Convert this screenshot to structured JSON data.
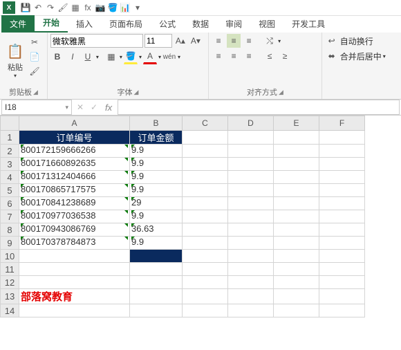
{
  "qat_icons": [
    "save-icon",
    "undo-icon",
    "redo-icon",
    "brush-icon",
    "border-icon",
    "fx-icon",
    "camera-icon",
    "fill-icon",
    "table-icon",
    "more-icon"
  ],
  "qat_glyphs": [
    "💾",
    "↶",
    "↷",
    "🖌",
    "▦",
    "fx",
    "📷",
    "🪣",
    "📊",
    "▾"
  ],
  "tabs": {
    "file": "文件",
    "home": "开始",
    "insert": "插入",
    "layout": "页面布局",
    "formula": "公式",
    "data": "数据",
    "review": "审阅",
    "view": "视图",
    "dev": "开发工具"
  },
  "ribbon": {
    "clipboard": {
      "paste": "粘贴",
      "label": "剪贴板"
    },
    "font": {
      "name": "微软雅黑",
      "size": "11",
      "label": "字体"
    },
    "align": {
      "wrap": "自动换行",
      "merge": "合并后居中",
      "label": "对齐方式"
    }
  },
  "namebox": "I18",
  "columns": [
    "A",
    "B",
    "C",
    "D",
    "E",
    "F"
  ],
  "header_row": {
    "A": "订单编号",
    "B": "订单金额"
  },
  "rows": [
    {
      "A": "800172159666266",
      "B": "9.9"
    },
    {
      "A": "800171660892635",
      "B": "9.9"
    },
    {
      "A": "800171312404666",
      "B": "9.9"
    },
    {
      "A": "800170865717575",
      "B": "9.9"
    },
    {
      "A": "800170841238689",
      "B": "29"
    },
    {
      "A": "800170977036538",
      "B": "9.9"
    },
    {
      "A": "800170943086769",
      "B": "36.63"
    },
    {
      "A": "800170378784873",
      "B": "9.9"
    }
  ],
  "brand_text": "部落窝教育",
  "chart_data": {
    "type": "table",
    "title": "",
    "columns": [
      "订单编号",
      "订单金额"
    ],
    "rows": [
      [
        "800172159666266",
        9.9
      ],
      [
        "800171660892635",
        9.9
      ],
      [
        "800171312404666",
        9.9
      ],
      [
        "800170865717575",
        9.9
      ],
      [
        "800170841238689",
        29
      ],
      [
        "800170977036538",
        9.9
      ],
      [
        "800170943086769",
        36.63
      ],
      [
        "800170378784873",
        9.9
      ]
    ]
  }
}
